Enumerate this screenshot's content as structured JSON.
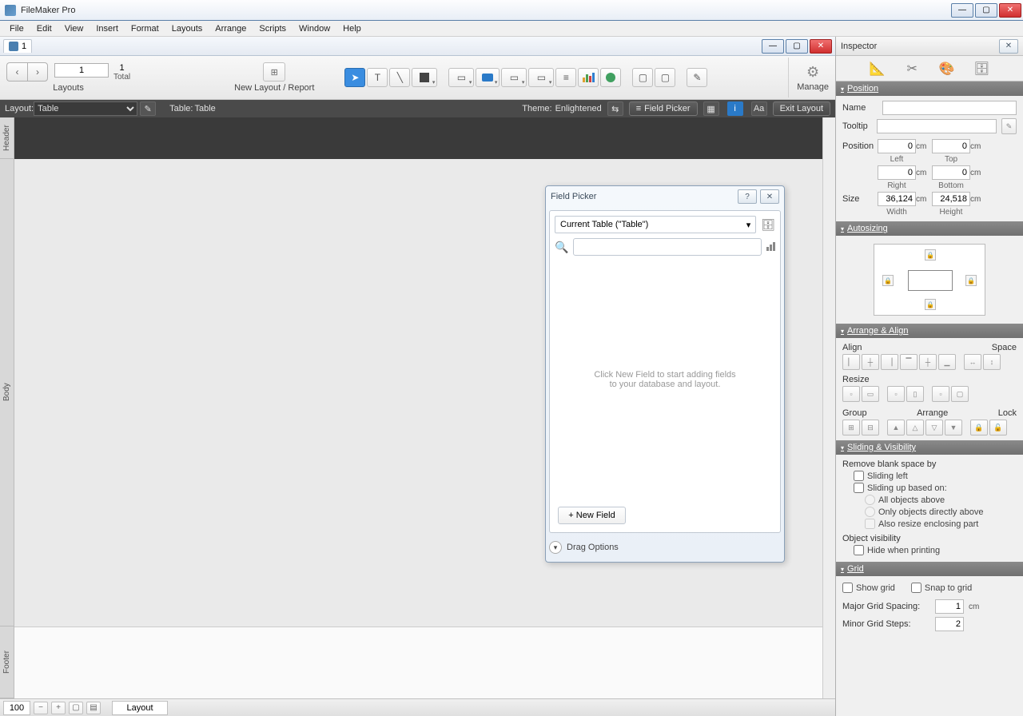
{
  "app": {
    "title": "FileMaker Pro"
  },
  "menus": [
    "File",
    "Edit",
    "View",
    "Insert",
    "Format",
    "Layouts",
    "Arrange",
    "Scripts",
    "Window",
    "Help"
  ],
  "doc": {
    "name": "1"
  },
  "toolbar": {
    "layout_number": "1",
    "layout_total": "1",
    "total_label": "Total",
    "layouts_label": "Layouts",
    "new_layout_label": "New Layout / Report",
    "manage_label": "Manage"
  },
  "darkbar": {
    "layout_label": "Layout:",
    "layout_value": "Table",
    "table_prefix": "Table:",
    "table_value": "Table",
    "theme_prefix": "Theme:",
    "theme_value": "Enlightened",
    "field_picker_label": "Field Picker",
    "exit_label": "Exit Layout"
  },
  "parts": {
    "header": "Header",
    "body": "Body",
    "footer": "Footer"
  },
  "field_picker": {
    "title": "Field Picker",
    "table_label": "Current Table (\"Table\")",
    "placeholder_line1": "Click New Field to start adding fields",
    "placeholder_line2": "to your database and layout.",
    "new_field_label": "+ New Field",
    "drag_label": "Drag Options"
  },
  "inspector": {
    "title": "Inspector",
    "sections": {
      "position": "Position",
      "autosizing": "Autosizing",
      "arrange": "Arrange & Align",
      "sliding": "Sliding & Visibility",
      "grid": "Grid"
    },
    "position": {
      "name_label": "Name",
      "tooltip_label": "Tooltip",
      "position_label": "Position",
      "left_val": "0",
      "left_label": "Left",
      "top_val": "0",
      "top_label": "Top",
      "right_val": "0",
      "right_label": "Right",
      "bottom_val": "0",
      "bottom_label": "Bottom",
      "size_label": "Size",
      "width_val": "36,124",
      "width_label": "Width",
      "height_val": "24,518",
      "height_label": "Height",
      "unit": "cm"
    },
    "arrange_labels": {
      "align": "Align",
      "space": "Space",
      "resize": "Resize",
      "group": "Group",
      "arrange": "Arrange",
      "lock": "Lock"
    },
    "sliding": {
      "remove_label": "Remove blank space by",
      "sliding_left": "Sliding left",
      "sliding_up": "Sliding up based on:",
      "all_above": "All objects above",
      "only_above": "Only objects directly above",
      "also_resize": "Also resize enclosing part",
      "visibility_label": "Object visibility",
      "hide_printing": "Hide when printing"
    },
    "grid": {
      "show_grid": "Show grid",
      "snap_grid": "Snap to grid",
      "major_label": "Major Grid Spacing:",
      "major_val": "1",
      "major_unit": "cm",
      "minor_label": "Minor Grid Steps:",
      "minor_val": "2"
    }
  },
  "status": {
    "zoom": "100",
    "mode": "Layout"
  }
}
